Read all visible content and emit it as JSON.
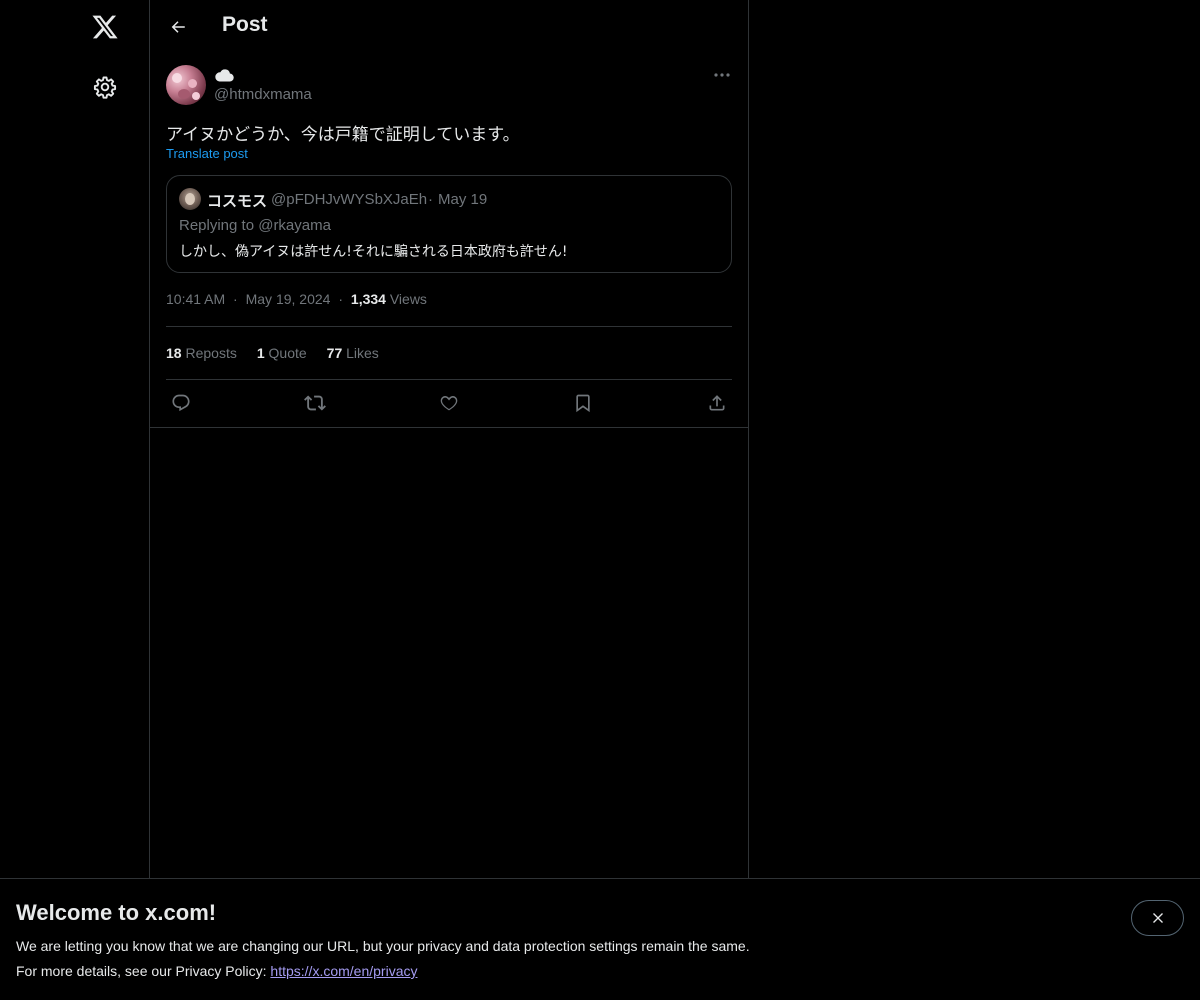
{
  "nav": {
    "logo_icon": "x-logo-icon",
    "settings_icon": "gear-icon"
  },
  "header": {
    "title": "Post",
    "back_icon": "arrow-left-icon"
  },
  "post": {
    "display_name_icon": "cloud-emoji-icon",
    "handle": "@htmdxmama",
    "text": "アイヌかどうか、今は戸籍で証明しています。",
    "translate_label": "Translate post",
    "time": "10:41 AM",
    "date": "May 19, 2024",
    "views_count": "1,334",
    "views_label": "Views",
    "separator": "·"
  },
  "quote": {
    "name": "コスモス",
    "handle": "@pFDHJvWYSbXJaEh",
    "separator": "·",
    "date": "May 19",
    "replying_to": "Replying to @rkayama",
    "text": "しかし、偽アイヌは許せん!それに騙される日本政府も許せん!"
  },
  "stats": {
    "reposts_count": "18",
    "reposts_label": "Reposts",
    "quote_count": "1",
    "quote_label": "Quote",
    "likes_count": "77",
    "likes_label": "Likes"
  },
  "actions": [
    "reply-icon",
    "repost-icon",
    "like-icon",
    "bookmark-icon",
    "share-icon"
  ],
  "banner": {
    "title": "Welcome to x.com!",
    "line1": "We are letting you know that we are changing our URL, but your privacy and data protection settings remain the same.",
    "line2_prefix": "For more details, see our Privacy Policy: ",
    "link": "https://x.com/en/privacy",
    "close_icon": "close-icon"
  },
  "colors": {
    "background": "#000000",
    "text": "#e7e9ea",
    "muted": "#71767b",
    "accent": "#1d9bf0",
    "border": "#2f3336",
    "link": "#a59cf2"
  }
}
